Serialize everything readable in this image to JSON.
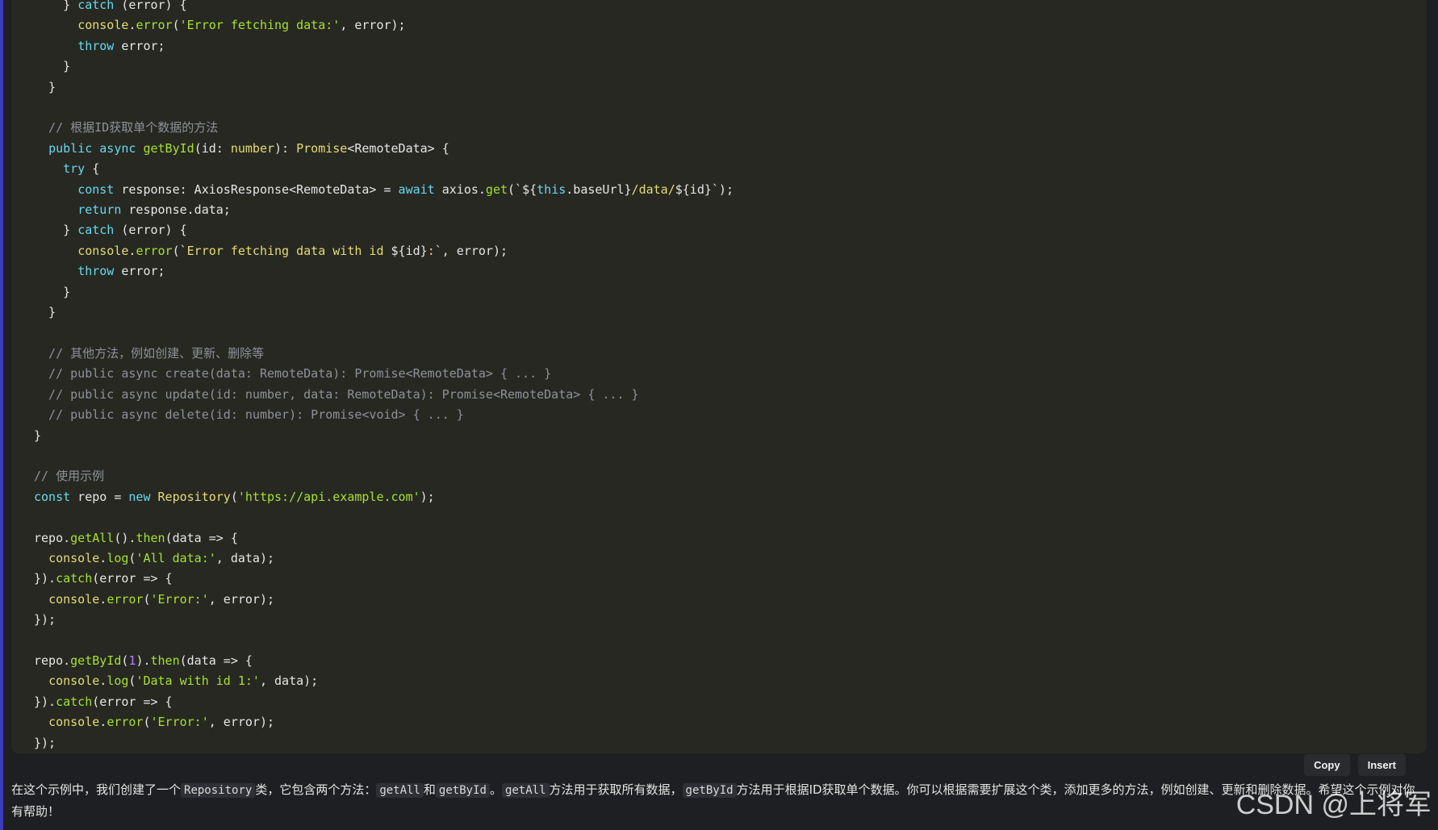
{
  "code_lines": [
    [
      {
        "t": "    } ",
        "c": "var"
      },
      {
        "t": "catch",
        "c": "kw"
      },
      {
        "t": " (error) {",
        "c": "var"
      }
    ],
    [
      {
        "t": "      ",
        "c": "var"
      },
      {
        "t": "console",
        "c": "ty"
      },
      {
        "t": ".",
        "c": "var"
      },
      {
        "t": "error",
        "c": "fn"
      },
      {
        "t": "(",
        "c": "var"
      },
      {
        "t": "'Error fetching data:'",
        "c": "str"
      },
      {
        "t": ", error);",
        "c": "var"
      }
    ],
    [
      {
        "t": "      ",
        "c": "var"
      },
      {
        "t": "throw",
        "c": "kw"
      },
      {
        "t": " error;",
        "c": "var"
      }
    ],
    [
      {
        "t": "    }",
        "c": "var"
      }
    ],
    [
      {
        "t": "  }",
        "c": "var"
      }
    ],
    [
      {
        "t": "",
        "c": "var"
      }
    ],
    [
      {
        "t": "  // 根据ID获取单个数据的方法",
        "c": "cm"
      }
    ],
    [
      {
        "t": "  ",
        "c": "var"
      },
      {
        "t": "public",
        "c": "kw"
      },
      {
        "t": " ",
        "c": "var"
      },
      {
        "t": "async",
        "c": "kw"
      },
      {
        "t": " ",
        "c": "var"
      },
      {
        "t": "getById",
        "c": "fn"
      },
      {
        "t": "(id: ",
        "c": "var"
      },
      {
        "t": "number",
        "c": "ty"
      },
      {
        "t": "): ",
        "c": "var"
      },
      {
        "t": "Promise",
        "c": "ty"
      },
      {
        "t": "<RemoteData> {",
        "c": "var"
      }
    ],
    [
      {
        "t": "    ",
        "c": "var"
      },
      {
        "t": "try",
        "c": "kw"
      },
      {
        "t": " {",
        "c": "var"
      }
    ],
    [
      {
        "t": "      ",
        "c": "var"
      },
      {
        "t": "const",
        "c": "kw"
      },
      {
        "t": " response: AxiosResponse<RemoteData> = ",
        "c": "var"
      },
      {
        "t": "await",
        "c": "kw"
      },
      {
        "t": " axios.",
        "c": "var"
      },
      {
        "t": "get",
        "c": "fn"
      },
      {
        "t": "(`${",
        "c": "var"
      },
      {
        "t": "this",
        "c": "kw"
      },
      {
        "t": ".baseUrl}",
        "c": "var"
      },
      {
        "t": "/data/",
        "c": "tpl"
      },
      {
        "t": "${id}`);",
        "c": "var"
      }
    ],
    [
      {
        "t": "      ",
        "c": "var"
      },
      {
        "t": "return",
        "c": "kw"
      },
      {
        "t": " response.data;",
        "c": "var"
      }
    ],
    [
      {
        "t": "    } ",
        "c": "var"
      },
      {
        "t": "catch",
        "c": "kw"
      },
      {
        "t": " (error) {",
        "c": "var"
      }
    ],
    [
      {
        "t": "      ",
        "c": "var"
      },
      {
        "t": "console",
        "c": "ty"
      },
      {
        "t": ".",
        "c": "var"
      },
      {
        "t": "error",
        "c": "fn"
      },
      {
        "t": "(`",
        "c": "var"
      },
      {
        "t": "Error fetching data with id ",
        "c": "tpl"
      },
      {
        "t": "${id}",
        "c": "var"
      },
      {
        "t": ":",
        "c": "tpl"
      },
      {
        "t": "`, error);",
        "c": "var"
      }
    ],
    [
      {
        "t": "      ",
        "c": "var"
      },
      {
        "t": "throw",
        "c": "kw"
      },
      {
        "t": " error;",
        "c": "var"
      }
    ],
    [
      {
        "t": "    }",
        "c": "var"
      }
    ],
    [
      {
        "t": "  }",
        "c": "var"
      }
    ],
    [
      {
        "t": "",
        "c": "var"
      }
    ],
    [
      {
        "t": "  // 其他方法，例如创建、更新、删除等",
        "c": "cm"
      }
    ],
    [
      {
        "t": "  // public async create(data: RemoteData): Promise<RemoteData> { ... }",
        "c": "cm"
      }
    ],
    [
      {
        "t": "  // public async update(id: number, data: RemoteData): Promise<RemoteData> { ... }",
        "c": "cm"
      }
    ],
    [
      {
        "t": "  // public async delete(id: number): Promise<void> { ... }",
        "c": "cm"
      }
    ],
    [
      {
        "t": "}",
        "c": "var"
      }
    ],
    [
      {
        "t": "",
        "c": "var"
      }
    ],
    [
      {
        "t": "// 使用示例",
        "c": "cm"
      }
    ],
    [
      {
        "t": "const",
        "c": "kw"
      },
      {
        "t": " repo = ",
        "c": "var"
      },
      {
        "t": "new",
        "c": "kw"
      },
      {
        "t": " ",
        "c": "var"
      },
      {
        "t": "Repository",
        "c": "ty"
      },
      {
        "t": "(",
        "c": "var"
      },
      {
        "t": "'https://api.example.com'",
        "c": "str"
      },
      {
        "t": ");",
        "c": "var"
      }
    ],
    [
      {
        "t": "",
        "c": "var"
      }
    ],
    [
      {
        "t": "repo.",
        "c": "var"
      },
      {
        "t": "getAll",
        "c": "fn"
      },
      {
        "t": "().",
        "c": "var"
      },
      {
        "t": "then",
        "c": "fn"
      },
      {
        "t": "(data => {",
        "c": "var"
      }
    ],
    [
      {
        "t": "  ",
        "c": "var"
      },
      {
        "t": "console",
        "c": "ty"
      },
      {
        "t": ".",
        "c": "var"
      },
      {
        "t": "log",
        "c": "fn"
      },
      {
        "t": "(",
        "c": "var"
      },
      {
        "t": "'All data:'",
        "c": "str"
      },
      {
        "t": ", data);",
        "c": "var"
      }
    ],
    [
      {
        "t": "}).",
        "c": "var"
      },
      {
        "t": "catch",
        "c": "fn"
      },
      {
        "t": "(error => {",
        "c": "var"
      }
    ],
    [
      {
        "t": "  ",
        "c": "var"
      },
      {
        "t": "console",
        "c": "ty"
      },
      {
        "t": ".",
        "c": "var"
      },
      {
        "t": "error",
        "c": "fn"
      },
      {
        "t": "(",
        "c": "var"
      },
      {
        "t": "'Error:'",
        "c": "str"
      },
      {
        "t": ", error);",
        "c": "var"
      }
    ],
    [
      {
        "t": "});",
        "c": "var"
      }
    ],
    [
      {
        "t": "",
        "c": "var"
      }
    ],
    [
      {
        "t": "repo.",
        "c": "var"
      },
      {
        "t": "getById",
        "c": "fn"
      },
      {
        "t": "(",
        "c": "var"
      },
      {
        "t": "1",
        "c": "num"
      },
      {
        "t": ").",
        "c": "var"
      },
      {
        "t": "then",
        "c": "fn"
      },
      {
        "t": "(data => {",
        "c": "var"
      }
    ],
    [
      {
        "t": "  ",
        "c": "var"
      },
      {
        "t": "console",
        "c": "ty"
      },
      {
        "t": ".",
        "c": "var"
      },
      {
        "t": "log",
        "c": "fn"
      },
      {
        "t": "(",
        "c": "var"
      },
      {
        "t": "'Data with id 1:'",
        "c": "str"
      },
      {
        "t": ", data);",
        "c": "var"
      }
    ],
    [
      {
        "t": "}).",
        "c": "var"
      },
      {
        "t": "catch",
        "c": "fn"
      },
      {
        "t": "(error => {",
        "c": "var"
      }
    ],
    [
      {
        "t": "  ",
        "c": "var"
      },
      {
        "t": "console",
        "c": "ty"
      },
      {
        "t": ".",
        "c": "var"
      },
      {
        "t": "error",
        "c": "fn"
      },
      {
        "t": "(",
        "c": "var"
      },
      {
        "t": "'Error:'",
        "c": "str"
      },
      {
        "t": ", error);",
        "c": "var"
      }
    ],
    [
      {
        "t": "});",
        "c": "var"
      }
    ]
  ],
  "toolbar": {
    "copy_label": "Copy",
    "insert_label": "Insert"
  },
  "answer": {
    "p1": "在这个示例中，我们创建了一个",
    "c1": "Repository",
    "p2": "类，它包含两个方法：",
    "c2": "getAll",
    "p3": "和",
    "c3": "getById",
    "p4": "。",
    "c4": "getAll",
    "p5": "方法用于获取所有数据，",
    "c5": "getById",
    "p6": "方法用于根据ID获取单个数据。你可以根据需要扩展这个类，添加更多的方法，例如创建、更新和删除数据。希望这个示例对你有帮助！"
  },
  "watermark": "CSDN @上将军"
}
